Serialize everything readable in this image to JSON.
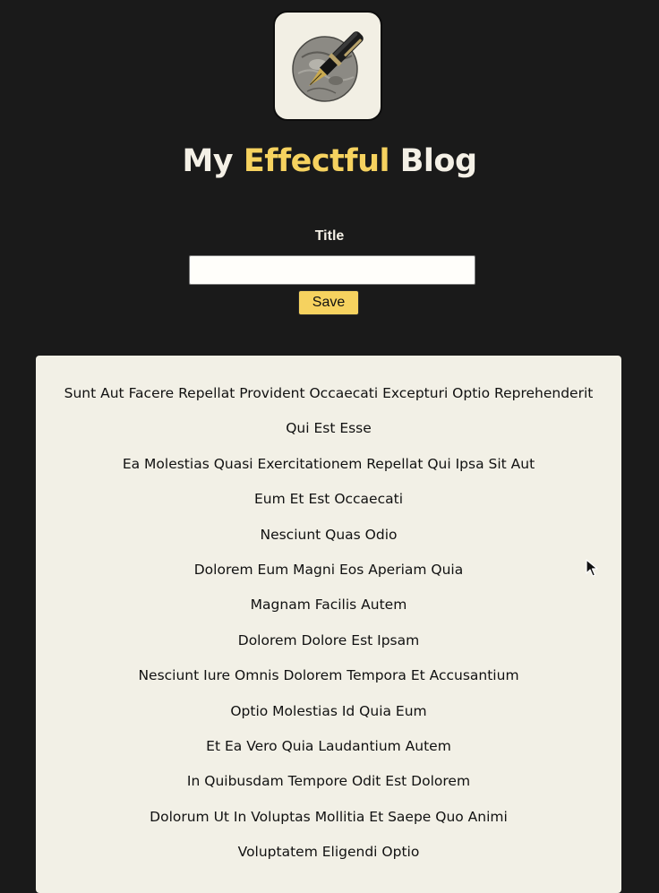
{
  "header": {
    "title_part1": "My ",
    "title_accent": "Effectful",
    "title_part2": " Blog"
  },
  "form": {
    "title_label": "Title",
    "title_value": "",
    "save_label": "Save"
  },
  "posts": [
    "Sunt Aut Facere Repellat Provident Occaecati Excepturi Optio Reprehenderit",
    "Qui Est Esse",
    "Ea Molestias Quasi Exercitationem Repellat Qui Ipsa Sit Aut",
    "Eum Et Est Occaecati",
    "Nesciunt Quas Odio",
    "Dolorem Eum Magni Eos Aperiam Quia",
    "Magnam Facilis Autem",
    "Dolorem Dolore Est Ipsam",
    "Nesciunt Iure Omnis Dolorem Tempora Et Accusantium",
    "Optio Molestias Id Quia Eum",
    "Et Ea Vero Quia Laudantium Autem",
    "In Quibusdam Tempore Odit Est Dolorem",
    "Dolorum Ut In Voluptas Mollitia Et Saepe Quo Animi",
    "Voluptatem Eligendi Optio"
  ],
  "colors": {
    "background": "#1a1a1a",
    "accent": "#f6d25f",
    "panel": "#f2f0e6",
    "text_light": "#f4f0e6"
  },
  "icons": {
    "logo": "fountain-pen-icon",
    "cursor": "mouse-pointer-icon"
  }
}
